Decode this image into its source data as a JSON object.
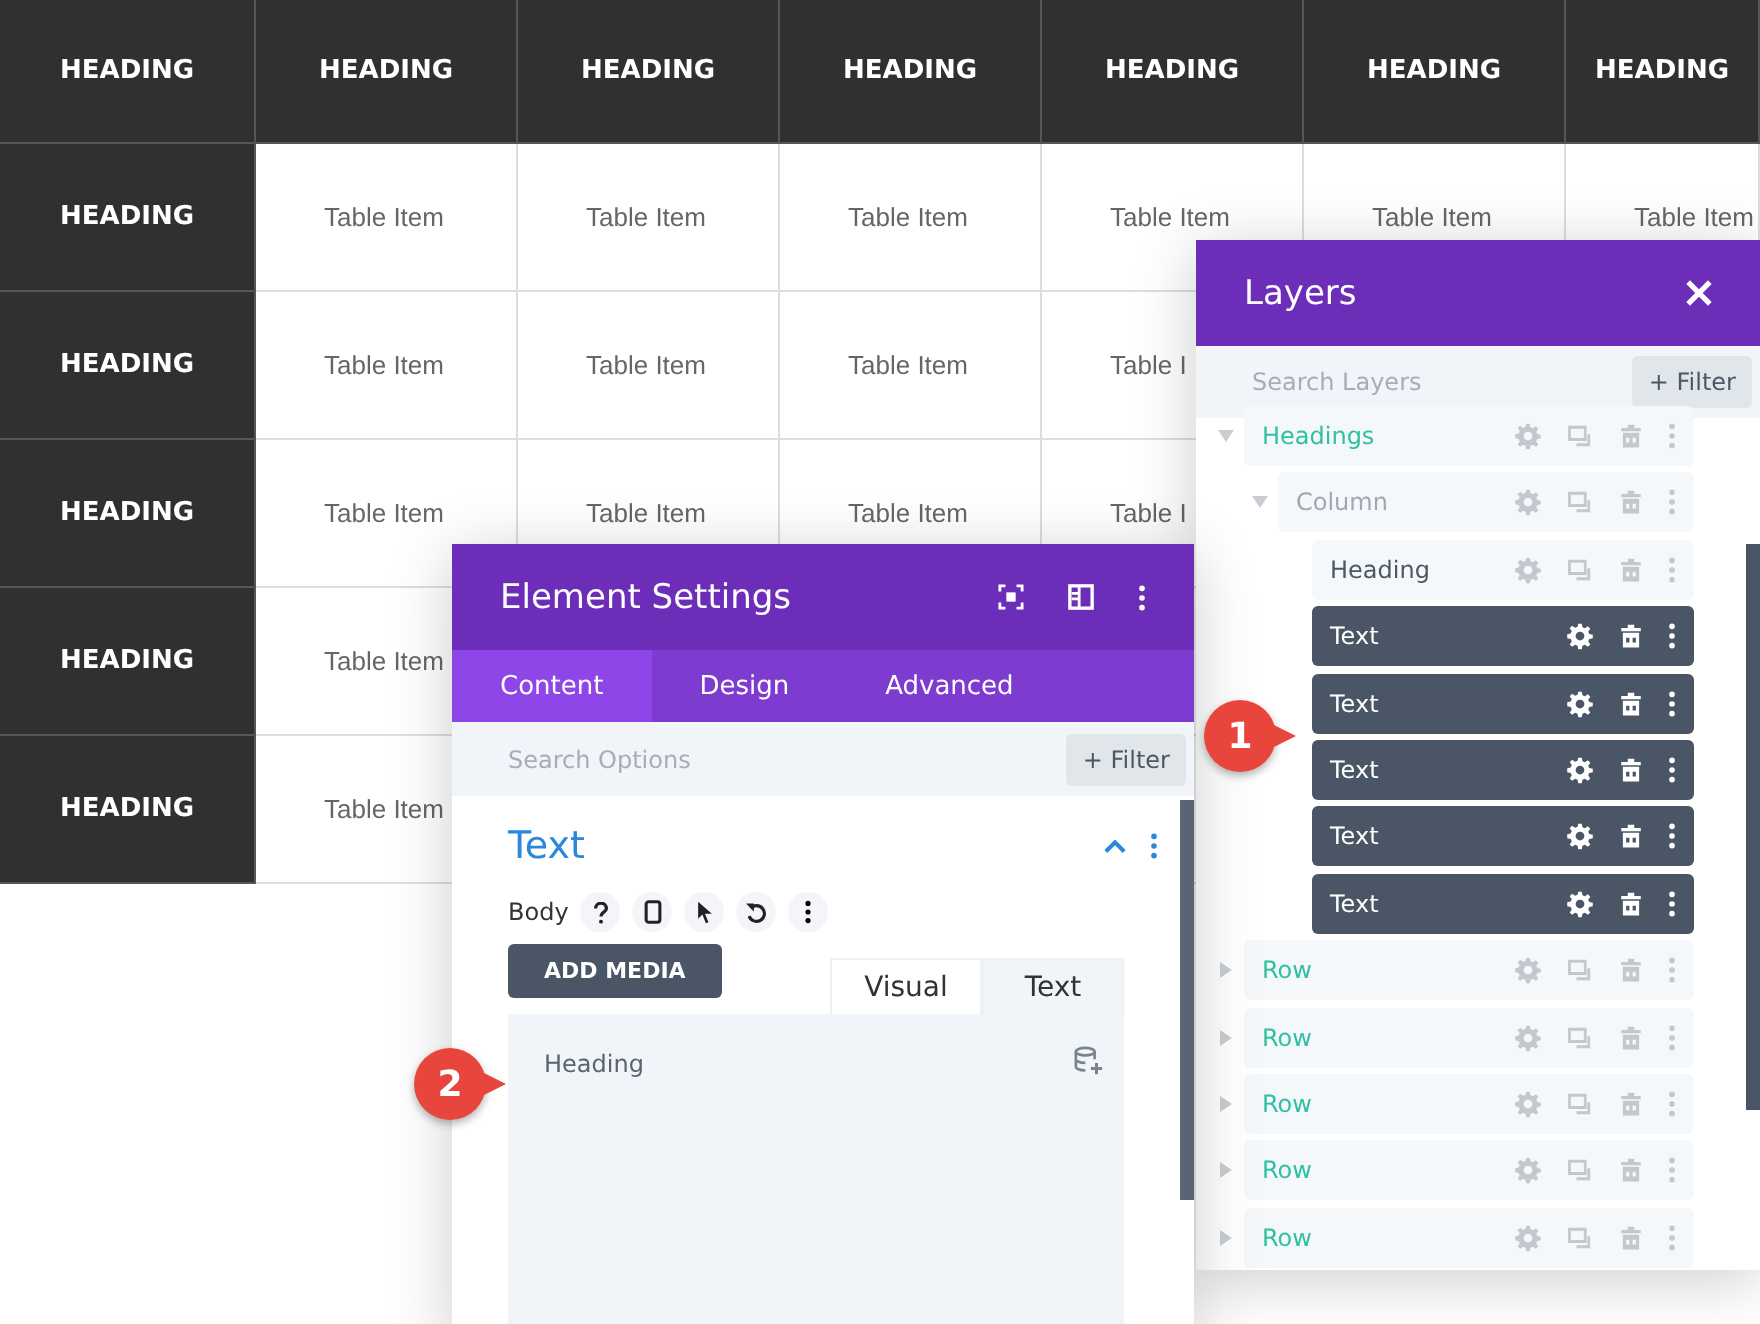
{
  "table": {
    "corner": "HEADING",
    "columns": [
      "HEADING",
      "HEADING",
      "HEADING",
      "HEADING",
      "HEADING",
      "HEADING"
    ],
    "rows": [
      {
        "header": "HEADING",
        "cells": [
          "Table Item",
          "Table Item",
          "Table Item",
          "Table Item",
          "Table Item",
          "Table Item"
        ]
      },
      {
        "header": "HEADING",
        "cells": [
          "Table Item",
          "Table Item",
          "Table Item",
          "Table I"
        ]
      },
      {
        "header": "HEADING",
        "cells": [
          "Table Item",
          "Table Item",
          "Table Item",
          "Table I"
        ]
      },
      {
        "header": "HEADING",
        "cells": [
          "Table Item"
        ]
      },
      {
        "header": "HEADING",
        "cells": [
          "Table Item"
        ]
      }
    ]
  },
  "layers_panel": {
    "title": "Layers",
    "search": {
      "placeholder": "Search Layers"
    },
    "filter_button": "+ Filter",
    "tree": [
      {
        "label": "Headings",
        "kind": "row",
        "selected": false,
        "expanded": true,
        "children": [
          {
            "label": "Column",
            "kind": "column",
            "selected": false,
            "expanded": true,
            "children": [
              {
                "label": "Heading",
                "kind": "module",
                "selected": false
              },
              {
                "label": "Text",
                "kind": "module",
                "selected": true
              },
              {
                "label": "Text",
                "kind": "module",
                "selected": true
              },
              {
                "label": "Text",
                "kind": "module",
                "selected": true
              },
              {
                "label": "Text",
                "kind": "module",
                "selected": true
              },
              {
                "label": "Text",
                "kind": "module",
                "selected": true
              }
            ]
          }
        ]
      },
      {
        "label": "Row",
        "kind": "row",
        "selected": false,
        "expanded": false
      },
      {
        "label": "Row",
        "kind": "row",
        "selected": false,
        "expanded": false
      },
      {
        "label": "Row",
        "kind": "row",
        "selected": false,
        "expanded": false
      },
      {
        "label": "Row",
        "kind": "row",
        "selected": false,
        "expanded": false
      },
      {
        "label": "Row",
        "kind": "row",
        "selected": false,
        "expanded": false
      }
    ]
  },
  "settings_panel": {
    "title": "Element Settings",
    "tabs": [
      {
        "label": "Content",
        "selected": true
      },
      {
        "label": "Design",
        "selected": false
      },
      {
        "label": "Advanced",
        "selected": false
      }
    ],
    "search": {
      "placeholder": "Search Options"
    },
    "filter_button": "+ Filter",
    "section": {
      "title": "Text",
      "expanded": true
    },
    "field_label": "Body",
    "add_media_button": "ADD MEDIA",
    "editor_tabs": [
      {
        "label": "Visual",
        "selected": false
      },
      {
        "label": "Text",
        "selected": true
      }
    ],
    "editor_value": "Heading"
  },
  "annotations": [
    {
      "label": "1"
    },
    {
      "label": "2"
    }
  ]
}
